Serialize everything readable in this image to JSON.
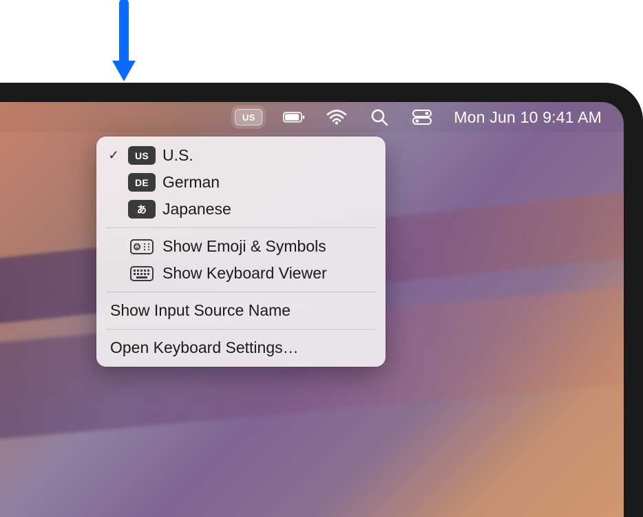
{
  "menubar": {
    "input_indicator": "US",
    "clock": "Mon Jun 10  9:41 AM"
  },
  "menu": {
    "sources": [
      {
        "checked": true,
        "badge": "US",
        "label": "U.S."
      },
      {
        "checked": false,
        "badge": "DE",
        "label": "German"
      },
      {
        "checked": false,
        "badge": "あ",
        "label": "Japanese"
      }
    ],
    "show_emoji": "Show Emoji & Symbols",
    "show_keyboard_viewer": "Show Keyboard Viewer",
    "show_input_source_name": "Show Input Source Name",
    "open_keyboard_settings": "Open Keyboard Settings…"
  }
}
